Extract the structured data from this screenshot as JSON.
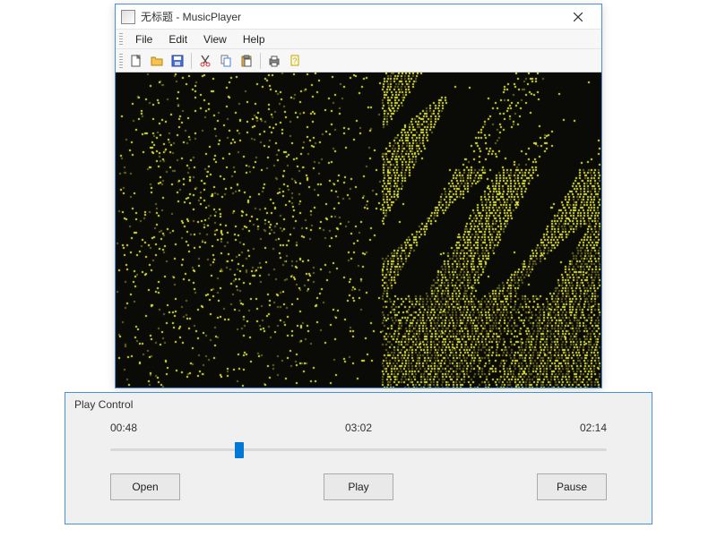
{
  "window": {
    "title": "无标题 - MusicPlayer"
  },
  "menu": {
    "file": "File",
    "edit": "Edit",
    "view": "View",
    "help": "Help"
  },
  "toolbar_icons": {
    "new": "new-file-icon",
    "open": "open-folder-icon",
    "save": "save-icon",
    "cut": "cut-icon",
    "copy": "copy-icon",
    "paste": "paste-icon",
    "print": "print-icon",
    "help": "help-icon"
  },
  "play_control": {
    "title": "Play Control",
    "time_elapsed": "00:48",
    "time_total": "03:02",
    "time_remaining": "02:14",
    "progress_percent": 26,
    "open_label": "Open",
    "play_label": "Play",
    "pause_label": "Pause"
  },
  "colors": {
    "accent": "#0078d7",
    "window_border": "#4a90d9",
    "viz_bg": "#0a0a06",
    "viz_dot_bright": "#e4e838",
    "viz_dot_dim": "#6a6a20"
  }
}
